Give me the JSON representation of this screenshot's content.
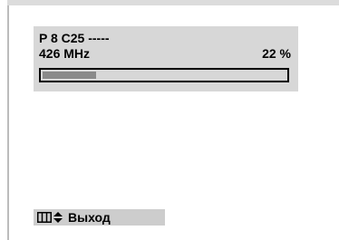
{
  "tuning": {
    "channel_line": "P 8 C25 -----",
    "frequency": "426 MHz",
    "progress_text": "22 %",
    "progress_fraction": 0.22
  },
  "footer": {
    "menu_icon": "menu-icon",
    "updown_icon": "up-down-arrows-icon",
    "exit_label": "Выход"
  }
}
